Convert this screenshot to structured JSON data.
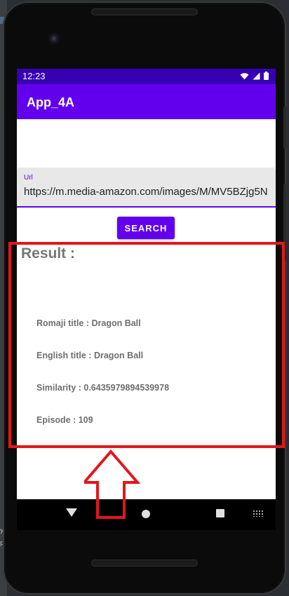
{
  "status_bar": {
    "time": "12:23"
  },
  "app_bar": {
    "title": "App_4A"
  },
  "url_field": {
    "label": "Url",
    "value": "https://m.media-amazon.com/images/M/MV5BZjg5N"
  },
  "search_button": {
    "label": "SEARCH"
  },
  "result": {
    "heading": "Result :",
    "lines": [
      "Romaji title : Dragon Ball",
      "English title : Dragon Ball",
      "Similarity : 0.6435979894539978",
      "Episode : 109"
    ]
  },
  "colors": {
    "primary": "#6200ee",
    "primary_dark": "#3700b3",
    "annotation": "#e3161b"
  },
  "icons": [
    "wifi-icon",
    "signal-icon",
    "battery-icon",
    "back-icon",
    "home-icon",
    "recents-icon",
    "keyboard-icon"
  ]
}
